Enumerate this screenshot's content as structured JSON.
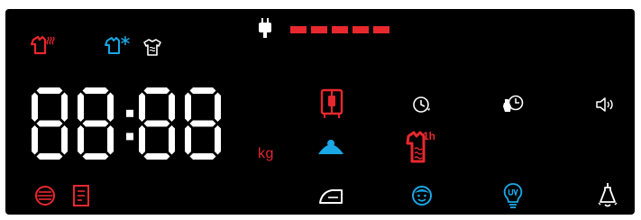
{
  "display": {
    "time_digits": "88:88",
    "unit_label": "kg",
    "load_level": 5,
    "load_level_max": 5
  },
  "badges": {
    "one_hour": "1h"
  },
  "colors": {
    "red": "#e8282e",
    "blue": "#1aa7e6",
    "white": "#ffffff",
    "background": "#000000"
  },
  "icons": [
    "plug-icon",
    "heated-shirt-icon",
    "cold-shirt-icon",
    "wrinkle-shirt-icon",
    "door-lock-icon",
    "delay-timer-icon",
    "rinse-hold-icon",
    "sound-icon",
    "spin-icon",
    "one-hour-wash-icon",
    "iron-icon",
    "child-lock-icon",
    "uv-icon",
    "light-bulb-icon",
    "drum-icon",
    "detergent-icon"
  ]
}
